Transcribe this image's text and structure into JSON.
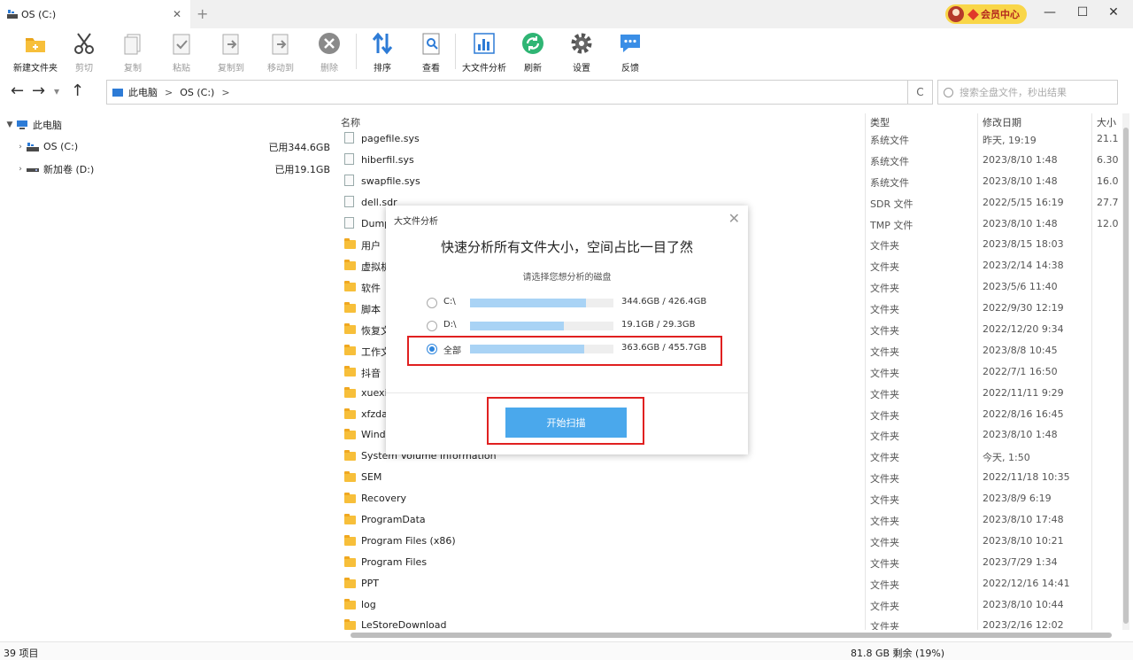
{
  "titlebar": {
    "tab_title": "OS (C:)",
    "close": "✕",
    "add": "+",
    "vip_label": "会员中心"
  },
  "window_buttons": {
    "minimize": "—",
    "maximize": "☐",
    "close": "✕"
  },
  "toolbar": [
    {
      "id": "new-folder",
      "label": "新建文件夹",
      "icon": "new-folder-icon",
      "enabled": true
    },
    {
      "id": "cut",
      "label": "剪切",
      "icon": "scissors-icon",
      "enabled": false
    },
    {
      "id": "copy",
      "label": "复制",
      "icon": "copy-icon",
      "enabled": false
    },
    {
      "id": "paste",
      "label": "粘贴",
      "icon": "paste-icon",
      "enabled": false
    },
    {
      "id": "copy-to",
      "label": "复制到",
      "icon": "copy-to-icon",
      "enabled": false
    },
    {
      "id": "move-to",
      "label": "移动到",
      "icon": "move-to-icon",
      "enabled": false
    },
    {
      "id": "delete",
      "label": "删除",
      "icon": "delete-icon",
      "enabled": false
    },
    {
      "id": "sort",
      "label": "排序",
      "icon": "sort-icon",
      "enabled": true
    },
    {
      "id": "view",
      "label": "查看",
      "icon": "view-icon",
      "enabled": true
    },
    {
      "id": "large-file-analysis",
      "label": "大文件分析",
      "icon": "chart-icon",
      "enabled": true
    },
    {
      "id": "refresh",
      "label": "刷新",
      "icon": "refresh-icon",
      "enabled": true
    },
    {
      "id": "settings",
      "label": "设置",
      "icon": "gear-icon",
      "enabled": true
    },
    {
      "id": "feedback",
      "label": "反馈",
      "icon": "chat-icon",
      "enabled": true
    }
  ],
  "nav": {
    "breadcrumb": [
      "此电脑",
      "OS (C:)"
    ],
    "breadcrumb_sep": ">",
    "search_placeholder": "搜索全盘文件，秒出结果",
    "back": "←",
    "forward": "→",
    "recent": "▾",
    "up": "↑",
    "refresh": "C"
  },
  "tree": {
    "root": "此电脑",
    "drives": [
      {
        "label": "OS (C:)",
        "used": "已用344.6GB"
      },
      {
        "label": "新加卷 (D:)",
        "used": "已用19.1GB"
      }
    ]
  },
  "list": {
    "columns": {
      "name": "名称",
      "type": "类型",
      "date": "修改日期",
      "size": "大小"
    },
    "rows": [
      {
        "name": "pagefile.sys",
        "type": "系统文件",
        "date": "昨天, 19:19",
        "size": "21.1",
        "kind": "file"
      },
      {
        "name": "hiberfil.sys",
        "type": "系统文件",
        "date": "2023/8/10 1:48",
        "size": "6.30",
        "kind": "file"
      },
      {
        "name": "swapfile.sys",
        "type": "系统文件",
        "date": "2023/8/10 1:48",
        "size": "16.0",
        "kind": "file"
      },
      {
        "name": "dell.sdr",
        "type": "SDR 文件",
        "date": "2022/5/15 16:19",
        "size": "27.7",
        "kind": "file"
      },
      {
        "name": "Dump",
        "type": "TMP 文件",
        "date": "2023/8/10 1:48",
        "size": "12.0",
        "kind": "file"
      },
      {
        "name": "用户",
        "type": "文件夹",
        "date": "2023/8/15 18:03",
        "size": "",
        "kind": "folder"
      },
      {
        "name": "虚拟机",
        "type": "文件夹",
        "date": "2023/2/14 14:38",
        "size": "",
        "kind": "folder"
      },
      {
        "name": "软件",
        "type": "文件夹",
        "date": "2023/5/6 11:40",
        "size": "",
        "kind": "folder"
      },
      {
        "name": "脚本",
        "type": "文件夹",
        "date": "2022/9/30 12:19",
        "size": "",
        "kind": "folder"
      },
      {
        "name": "恢复文",
        "type": "文件夹",
        "date": "2022/12/20 9:34",
        "size": "",
        "kind": "folder"
      },
      {
        "name": "工作文",
        "type": "文件夹",
        "date": "2023/8/8 10:45",
        "size": "",
        "kind": "folder"
      },
      {
        "name": "抖音",
        "type": "文件夹",
        "date": "2022/7/1 16:50",
        "size": "",
        "kind": "folder"
      },
      {
        "name": "xuexi",
        "type": "文件夹",
        "date": "2022/11/11 9:29",
        "size": "",
        "kind": "folder"
      },
      {
        "name": "xfzda",
        "type": "文件夹",
        "date": "2022/8/16 16:45",
        "size": "",
        "kind": "folder"
      },
      {
        "name": "Wind",
        "type": "文件夹",
        "date": "2023/8/10 1:48",
        "size": "",
        "kind": "folder"
      },
      {
        "name": "System Volume Information",
        "type": "文件夹",
        "date": "今天, 1:50",
        "size": "",
        "kind": "folder"
      },
      {
        "name": "SEM",
        "type": "文件夹",
        "date": "2022/11/18 10:35",
        "size": "",
        "kind": "folder"
      },
      {
        "name": "Recovery",
        "type": "文件夹",
        "date": "2023/8/9 6:19",
        "size": "",
        "kind": "folder"
      },
      {
        "name": "ProgramData",
        "type": "文件夹",
        "date": "2023/8/10 17:48",
        "size": "",
        "kind": "folder"
      },
      {
        "name": "Program Files (x86)",
        "type": "文件夹",
        "date": "2023/8/10 10:21",
        "size": "",
        "kind": "folder"
      },
      {
        "name": "Program Files",
        "type": "文件夹",
        "date": "2023/7/29 1:34",
        "size": "",
        "kind": "folder"
      },
      {
        "name": "PPT",
        "type": "文件夹",
        "date": "2022/12/16 14:41",
        "size": "",
        "kind": "folder"
      },
      {
        "name": "log",
        "type": "文件夹",
        "date": "2023/8/10 10:44",
        "size": "",
        "kind": "folder"
      },
      {
        "name": "LeStoreDownload",
        "type": "文件夹",
        "date": "2023/2/16 12:02",
        "size": "",
        "kind": "folder"
      }
    ]
  },
  "status": {
    "count": "39 项目",
    "free": "81.8 GB 剩余 (19%)"
  },
  "dialog": {
    "title": "大文件分析",
    "close": "✕",
    "heading": "快速分析所有文件大小，空间占比一目了然",
    "subheading": "请选择您想分析的磁盘",
    "options": [
      {
        "label": "C:\\",
        "value": "344.6GB / 426.4GB",
        "fraction": 0.808,
        "selected": false
      },
      {
        "label": "D:\\",
        "value": "19.1GB / 29.3GB",
        "fraction": 0.652,
        "selected": false
      },
      {
        "label": "全部",
        "value": "363.6GB / 455.7GB",
        "fraction": 0.798,
        "selected": true
      }
    ],
    "scan_button": "开始扫描"
  },
  "colors": {
    "accent": "#4aa8ec",
    "highlight": "#e02020",
    "bar_fill": "#a9d3f5",
    "vip": "#f9d648"
  }
}
